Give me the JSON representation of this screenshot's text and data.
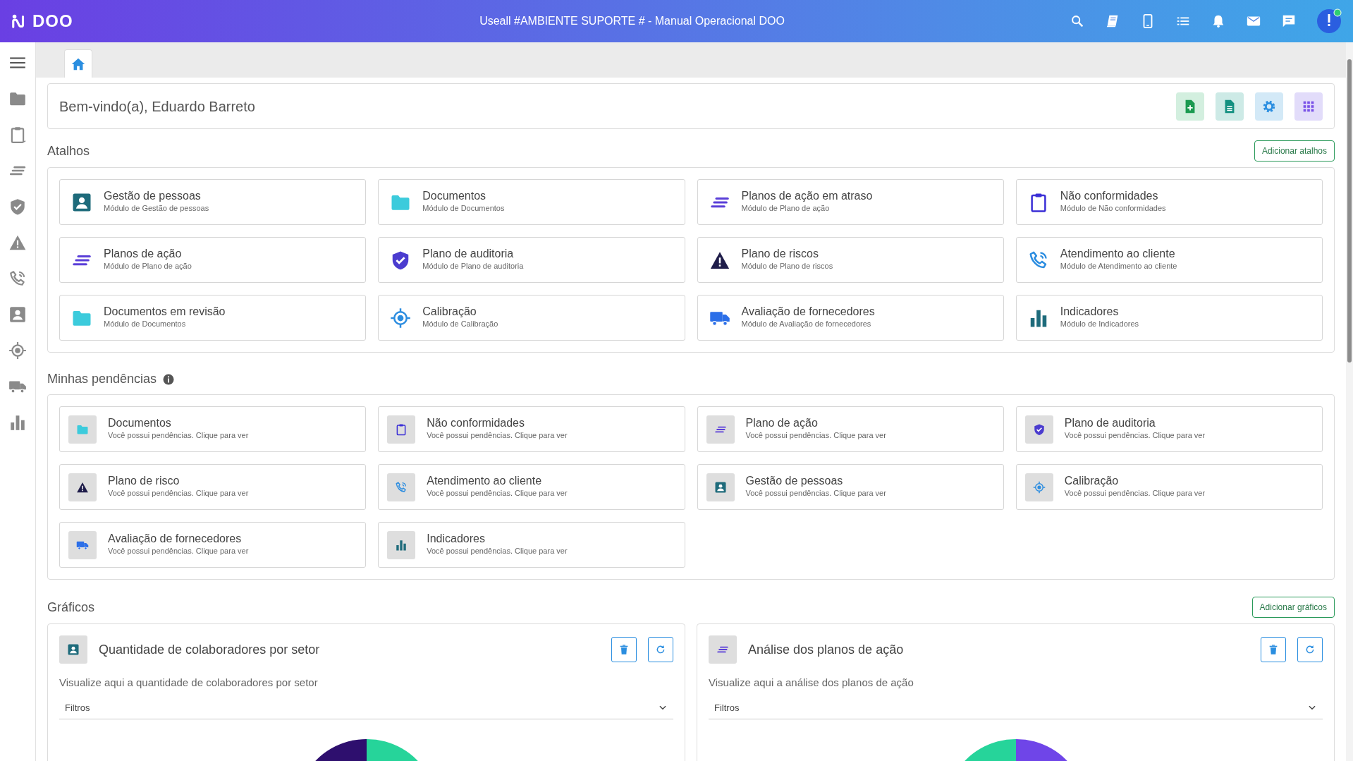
{
  "app": {
    "brand": "DOO",
    "title": "Useall #AMBIENTE SUPORTE # - Manual Operacional DOO"
  },
  "welcome": {
    "text": "Bem-vindo(a), Eduardo Barreto"
  },
  "shortcuts": {
    "title": "Atalhos",
    "add_button": "Adicionar atalhos",
    "items": [
      {
        "kind": "people",
        "title": "Gestão de pessoas",
        "subtitle": "Módulo de Gestão de pessoas"
      },
      {
        "kind": "folder",
        "title": "Documentos",
        "subtitle": "Módulo de Documentos"
      },
      {
        "kind": "lines",
        "title": "Planos de ação em atraso",
        "subtitle": "Módulo de Plano de ação"
      },
      {
        "kind": "clipboard",
        "title": "Não conformidades",
        "subtitle": "Módulo de Não conformidades"
      },
      {
        "kind": "lines",
        "title": "Planos de ação",
        "subtitle": "Módulo de Plano de ação"
      },
      {
        "kind": "shield",
        "title": "Plano de auditoria",
        "subtitle": "Módulo de Plano de auditoria"
      },
      {
        "kind": "warning",
        "title": "Plano de riscos",
        "subtitle": "Módulo de Plano de riscos"
      },
      {
        "kind": "phone",
        "title": "Atendimento ao cliente",
        "subtitle": "Módulo de Atendimento ao cliente"
      },
      {
        "kind": "folder",
        "title": "Documentos em revisão",
        "subtitle": "Módulo de Documentos"
      },
      {
        "kind": "target",
        "title": "Calibração",
        "subtitle": "Módulo de Calibração"
      },
      {
        "kind": "truck",
        "title": "Avaliação de fornecedores",
        "subtitle": "Módulo de Avaliação de fornecedores"
      },
      {
        "kind": "bars",
        "title": "Indicadores",
        "subtitle": "Módulo de Indicadores"
      }
    ]
  },
  "pending": {
    "title": "Minhas pendências",
    "items": [
      {
        "kind": "folder",
        "title": "Documentos",
        "subtitle": "Você possui pendências. Clique para ver"
      },
      {
        "kind": "clipboard",
        "title": "Não conformidades",
        "subtitle": "Você possui pendências. Clique para ver"
      },
      {
        "kind": "lines",
        "title": "Plano de ação",
        "subtitle": "Você possui pendências. Clique para ver"
      },
      {
        "kind": "shield",
        "title": "Plano de auditoria",
        "subtitle": "Você possui pendências. Clique para ver"
      },
      {
        "kind": "warning",
        "title": "Plano de risco",
        "subtitle": "Você possui pendências. Clique para ver"
      },
      {
        "kind": "phone",
        "title": "Atendimento ao cliente",
        "subtitle": "Você possui pendências. Clique para ver"
      },
      {
        "kind": "people",
        "title": "Gestão de pessoas",
        "subtitle": "Você possui pendências. Clique para ver"
      },
      {
        "kind": "target",
        "title": "Calibração",
        "subtitle": "Você possui pendências. Clique para ver"
      },
      {
        "kind": "truck",
        "title": "Avaliação de fornecedores",
        "subtitle": "Você possui pendências. Clique para ver"
      },
      {
        "kind": "bars",
        "title": "Indicadores",
        "subtitle": "Você possui pendências. Clique para ver"
      }
    ]
  },
  "charts": {
    "title": "Gráficos",
    "add_button": "Adicionar gráficos",
    "items": [
      {
        "kind": "people",
        "title": "Quantidade de colaboradores por setor",
        "description": "Visualize aqui a quantidade de colaboradores por setor",
        "filter_label": "Filtros"
      },
      {
        "kind": "lines",
        "title": "Análise dos planos de ação",
        "description": "Visualize aqui a análise dos planos de ação",
        "filter_label": "Filtros"
      }
    ]
  }
}
